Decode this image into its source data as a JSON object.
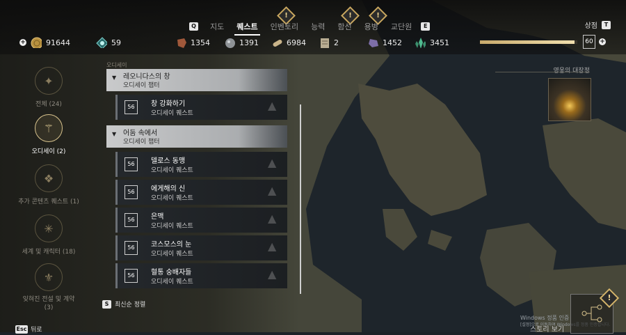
{
  "tabs": {
    "left_key": "Q",
    "right_key": "E",
    "items": [
      {
        "label": "지도",
        "active": false,
        "alert": false
      },
      {
        "label": "퀘스트",
        "active": true,
        "alert": false
      },
      {
        "label": "인벤토리",
        "active": false,
        "alert": true
      },
      {
        "label": "능력",
        "active": false,
        "alert": false
      },
      {
        "label": "함선",
        "active": false,
        "alert": true
      },
      {
        "label": "용병",
        "active": false,
        "alert": true
      },
      {
        "label": "교단원",
        "active": false,
        "alert": false
      }
    ],
    "alert_glyph": "!"
  },
  "shop": {
    "label": "상점",
    "key": "T"
  },
  "resources": {
    "drachmae": "91644",
    "ability_points": "59",
    "leather": "1354",
    "iron": "1391",
    "wood": "6984",
    "tablets": "2",
    "obsidian": "1452",
    "crystals": "3451"
  },
  "player": {
    "level": "60",
    "xp_fraction": 0.97
  },
  "categories": [
    {
      "label": "전체 (24)",
      "icon": "all-quests-icon",
      "active": false
    },
    {
      "label": "오디세이 (2)",
      "icon": "odyssey-icon",
      "active": true
    },
    {
      "label": "추가 콘텐츠 퀘스트 (1)",
      "icon": "dlc-icon",
      "active": false
    },
    {
      "label": "세계 및 캐릭터 (18)",
      "icon": "world-icon",
      "active": false
    },
    {
      "label": "잊혀진 전설 및 계약 (3)",
      "icon": "legends-icon",
      "active": false
    }
  ],
  "quest_section_label": "오디세이",
  "chapters": [
    {
      "title": "레오니다스의 창",
      "subtitle": "오디세이 챕터"
    },
    {
      "title": "어둠 속에서",
      "subtitle": "오디세이 챕터"
    }
  ],
  "quests": [
    {
      "level": "56",
      "title": "창 강화하기",
      "subtitle": "오디세이 퀘스트"
    },
    {
      "level": "56",
      "title": "델로스 동맹",
      "subtitle": "오디세이 퀘스트"
    },
    {
      "level": "56",
      "title": "에게해의 신",
      "subtitle": "오디세이 퀘스트"
    },
    {
      "level": "56",
      "title": "은맥",
      "subtitle": "오디세이 퀘스트"
    },
    {
      "level": "56",
      "title": "코스모스의 눈",
      "subtitle": "오디세이 퀘스트"
    },
    {
      "level": "56",
      "title": "혈통 숭배자들",
      "subtitle": "오디세이 퀘스트"
    }
  ],
  "sort": {
    "key": "S",
    "label": "최신순 정렬"
  },
  "back": {
    "key": "Esc",
    "label": "뒤로"
  },
  "hall": {
    "label": "영웅의 대장정"
  },
  "windows": {
    "line1": "Windows 정품 인증",
    "line2": "[설정]으로 이동하여 Windows를 정품 인증합니다."
  },
  "explore": {
    "label": "스토리 보기"
  },
  "colors": {
    "accent_gold": "#c9a75f",
    "selected_tab": "#ffffff",
    "chapter_bg": "#c9cacb"
  }
}
